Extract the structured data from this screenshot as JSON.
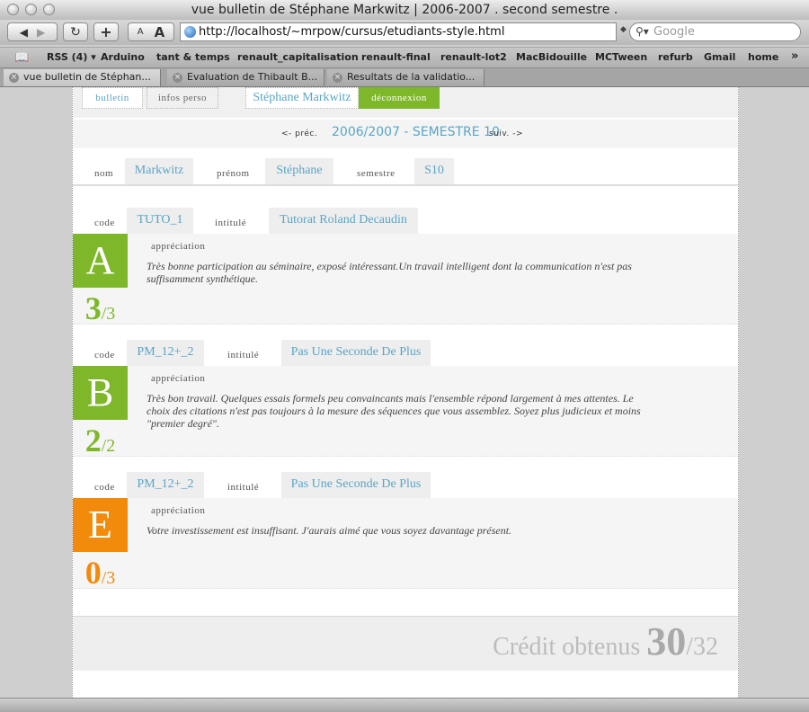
{
  "window": {
    "title": "vue bulletin de Stéphane Markwitz | 2006-2007 . second semestre ."
  },
  "toolbar": {
    "font_small": "A",
    "font_large": "A",
    "reload_icon": "reload-icon",
    "add_icon": "plus-icon",
    "url": "http://localhost/~mrpow/cursus/etudiants-style.html",
    "search_placeholder": "Google"
  },
  "bookmarks": [
    "RSS (4) ▾",
    "Arduino",
    "tant & temps",
    "renault_capitalisation",
    "renault-final",
    "renault-lot2",
    "MacBidouille",
    "MCTween",
    "refurb",
    "Gmail",
    "home"
  ],
  "bookmarks_overflow": "»",
  "tabs": [
    {
      "label": "vue bulletin de Stéphan..."
    },
    {
      "label": "Evaluation de Thibault B..."
    },
    {
      "label": "Resultats de la validatio..."
    }
  ],
  "nav": {
    "bulletin": "bulletin",
    "infos_perso": "infos perso",
    "user_name": "Stéphane Markwitz",
    "logout": "déconnexion"
  },
  "period": {
    "prev": "<- préc.",
    "title": "2006/2007 - SEMESTRE 10",
    "next": "suiv. ->"
  },
  "student": {
    "nom_label": "nom",
    "nom": "Markwitz",
    "prenom_label": "prénom",
    "prenom": "Stéphane",
    "semestre_label": "semestre",
    "semestre": "S10"
  },
  "courses": [
    {
      "code_label": "code",
      "code": "TUTO_1",
      "intitule_label": "intitulé",
      "intitule": "Tutorat Roland Decaudin",
      "grade": "A",
      "grade_color": "#7eb82a",
      "score": "3",
      "score_max": "/3",
      "appreciation_label": "appréciation",
      "appreciation": "Très bonne participation au séminaire, exposé intéressant.Un travail intelligent dont la communication n'est pas suffisamment synthétique."
    },
    {
      "code_label": "code",
      "code": "PM_12+_2",
      "intitule_label": "intitulé",
      "intitule": "Pas Une Seconde De Plus",
      "grade": "B",
      "grade_color": "#7eb82a",
      "score": "2",
      "score_max": "/2",
      "appreciation_label": "appréciation",
      "appreciation": "Très bon travail. Quelques essais formels peu convaincants mais l'ensemble répond largement à mes attentes. Le choix des citations n'est pas toujours à la mesure des séquences que vous assemblez. Soyez plus judicieux et moins \"premier degré\"."
    },
    {
      "code_label": "code",
      "code": "PM_12+_2",
      "intitule_label": "intitulé",
      "intitule": "Pas Une Seconde De Plus",
      "grade": "E",
      "grade_color": "#f28a0c",
      "score": "0",
      "score_max": "/3",
      "appreciation_label": "appréciation",
      "appreciation": "Votre investissement est insuffisant. J'aurais aimé que vous soyez davantage présent."
    }
  ],
  "credit": {
    "label": "Crédit obtenus ",
    "value": "30",
    "max": "/32"
  }
}
